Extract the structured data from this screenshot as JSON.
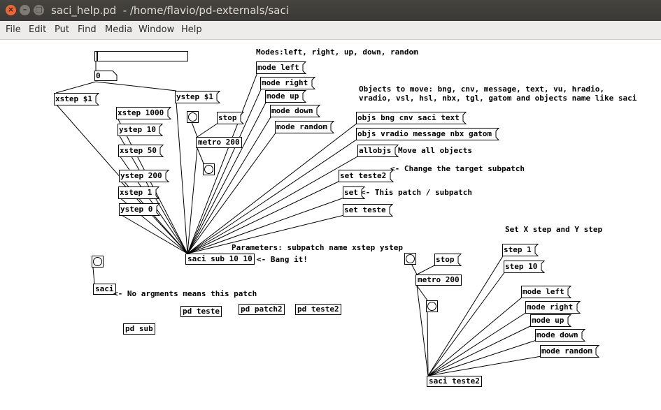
{
  "window": {
    "title": "saci_help.pd  - /home/flavio/pd-externals/saci",
    "close_glyph": "×",
    "min_glyph": "–",
    "max_glyph": "□"
  },
  "menu": [
    "File",
    "Edit",
    "Put",
    "Find",
    "Media",
    "Window",
    "Help"
  ],
  "number_box": "0",
  "messages": {
    "xstep_var": "xstep $1",
    "ystep_var": "ystep $1",
    "xstep_1000": "xstep 1000",
    "ystep_10": "ystep 10",
    "xstep_50": "xstep 50",
    "ystep_200": "ystep 200",
    "xstep_1": "xstep 1",
    "ystep_0": "ystep 0",
    "stop_1": "stop",
    "mode_left_1": "mode left",
    "mode_right_1": "mode right",
    "mode_up_1": "mode up",
    "mode_down_1": "mode down",
    "mode_random_1": "mode random",
    "objs_1": "objs bng cnv saci text",
    "objs_2": "objs vradio message nbx gatom",
    "allobjs": "allobjs",
    "set_teste2": "set teste2",
    "set": "set",
    "set_teste": "set teste",
    "stop_2": "stop",
    "step_1": "step 1",
    "step_10": "step 10",
    "mode_left_2": "mode left",
    "mode_right_2": "mode right",
    "mode_up_2": "mode up",
    "mode_down_2": "mode down",
    "mode_random_2": "mode random"
  },
  "objects": {
    "metro_1": "metro 200",
    "saci_main": "saci sub 10 10",
    "saci_plain": "saci",
    "pd_teste": "pd teste",
    "pd_patch2": "pd patch2",
    "pd_teste2": "pd teste2",
    "pd_sub": "pd sub",
    "metro_2": "metro 200",
    "saci_teste2": "saci teste2"
  },
  "comments": {
    "modes": "Modes:left, right, up, down, random",
    "objects_to_move": "Objects to move: bng, cnv, message, text, vu, hradio,\nvradio, vsl, hsl, nbx, tgl, gatom and objects name like saci",
    "move_all": "Move all objects",
    "change_target": "<- Change the target subpatch",
    "this_patch": "<- This patch / subpatch",
    "parameters": "Parameters: subpatch name xstep ystep",
    "bang_it": "<- Bang it!",
    "no_args": "<- No argments means this patch",
    "set_xy": "Set X step and Y step"
  }
}
